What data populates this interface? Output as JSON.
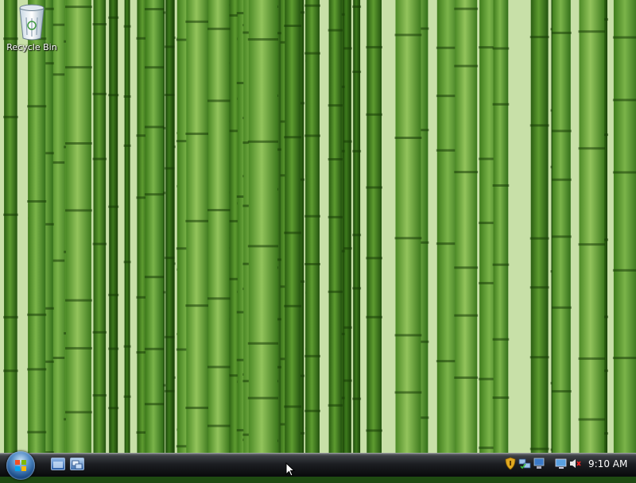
{
  "desktop": {
    "wallpaper": "bamboo-forest",
    "icons": [
      {
        "label": "Recycle Bin",
        "icon": "recycle-bin-icon"
      }
    ]
  },
  "taskbar": {
    "start_button": {
      "icon": "windows-orb-icon"
    },
    "quick_launch": [
      {
        "icon": "show-desktop-icon"
      },
      {
        "icon": "switch-windows-icon"
      }
    ],
    "tray_icons": [
      "shield-icon",
      "network-icon",
      "volume-muted-icon"
    ],
    "clock": "9:10 AM"
  },
  "colors": {
    "taskbar": "#1c1e22",
    "bamboo_green": "#4e8a25",
    "start_orb": "#2f6fb5"
  }
}
